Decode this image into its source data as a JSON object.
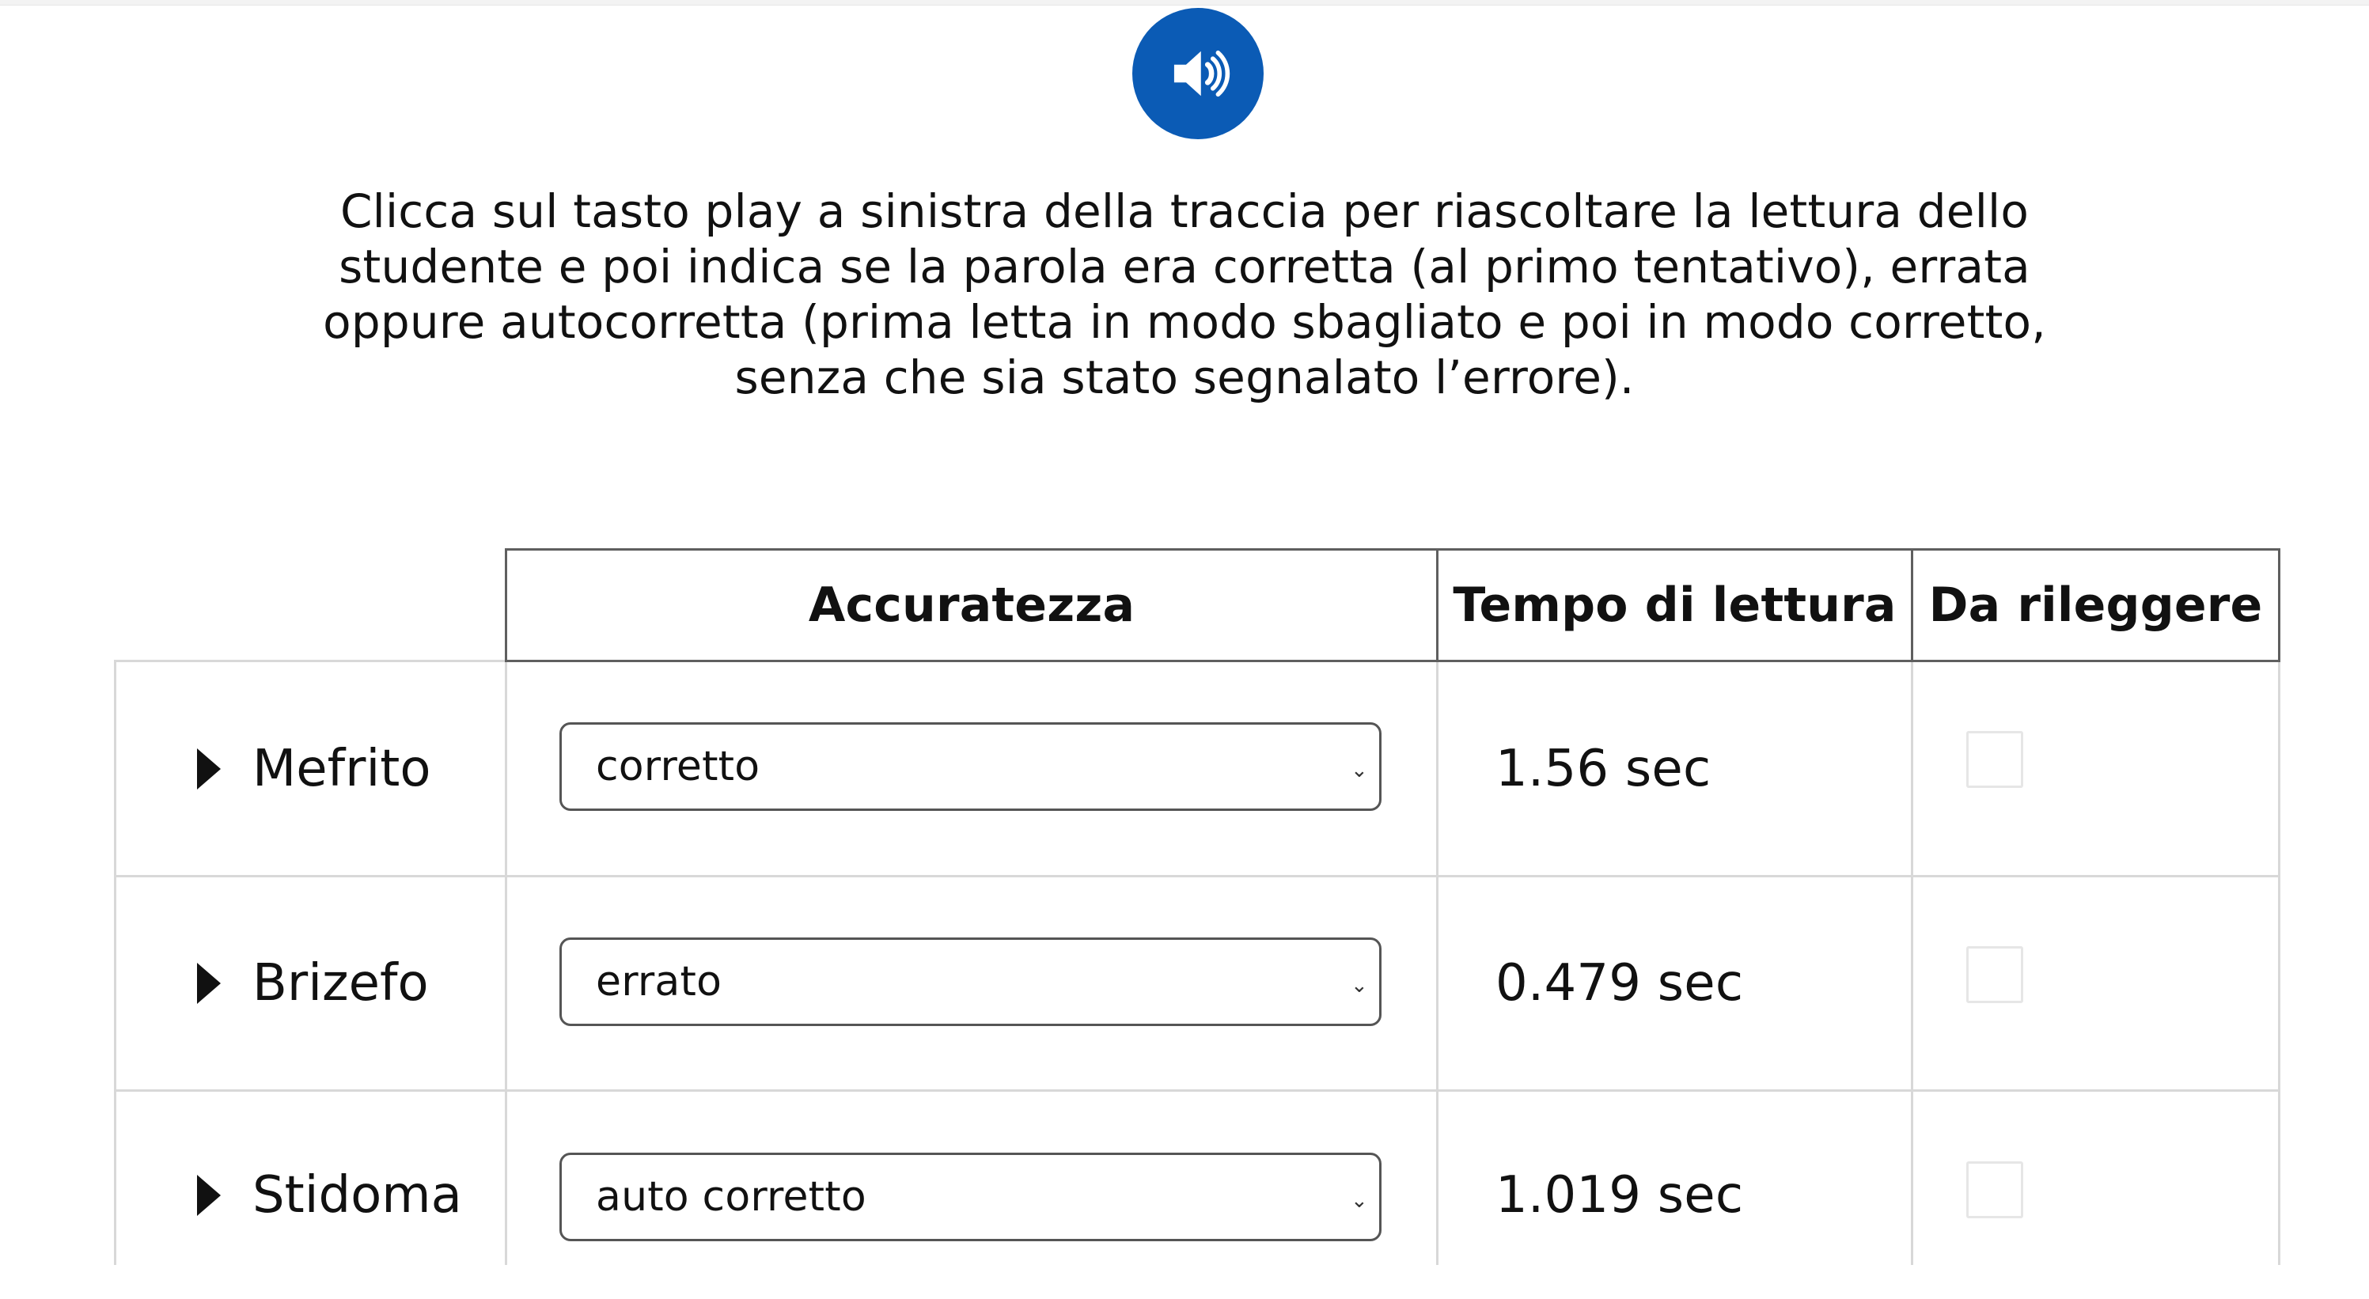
{
  "header": {
    "audio_icon": "speaker-volume-icon",
    "instructions": "Clicca sul tasto play a sinistra della traccia per riascoltare la lettura dello studente e poi indica se la parola era corretta (al primo tentativo), errata oppure autocorretta (prima letta in modo sbagliato e poi in modo corretto, senza che sia stato segnalato l’errore)."
  },
  "table": {
    "columns": [
      "Accuratezza",
      "Tempo di lettura",
      "Da rileggere"
    ],
    "rows": [
      {
        "word": "Mefrito",
        "accuracy": "corretto",
        "time": "1.56 sec",
        "reread": false
      },
      {
        "word": "Brizefo",
        "accuracy": "errato",
        "time": "0.479 sec",
        "reread": false
      },
      {
        "word": "Stidoma",
        "accuracy": "auto corretto",
        "time": "1.019 sec",
        "reread": false
      }
    ]
  },
  "colors": {
    "accent": "#0b5bb5",
    "text": "#111111",
    "grid": "#d8d8d8",
    "header_border": "#5f5f5f"
  },
  "icons": {
    "play": "play-icon",
    "dropdown": "chevron-down-icon",
    "checkbox": "checkbox-icon"
  }
}
